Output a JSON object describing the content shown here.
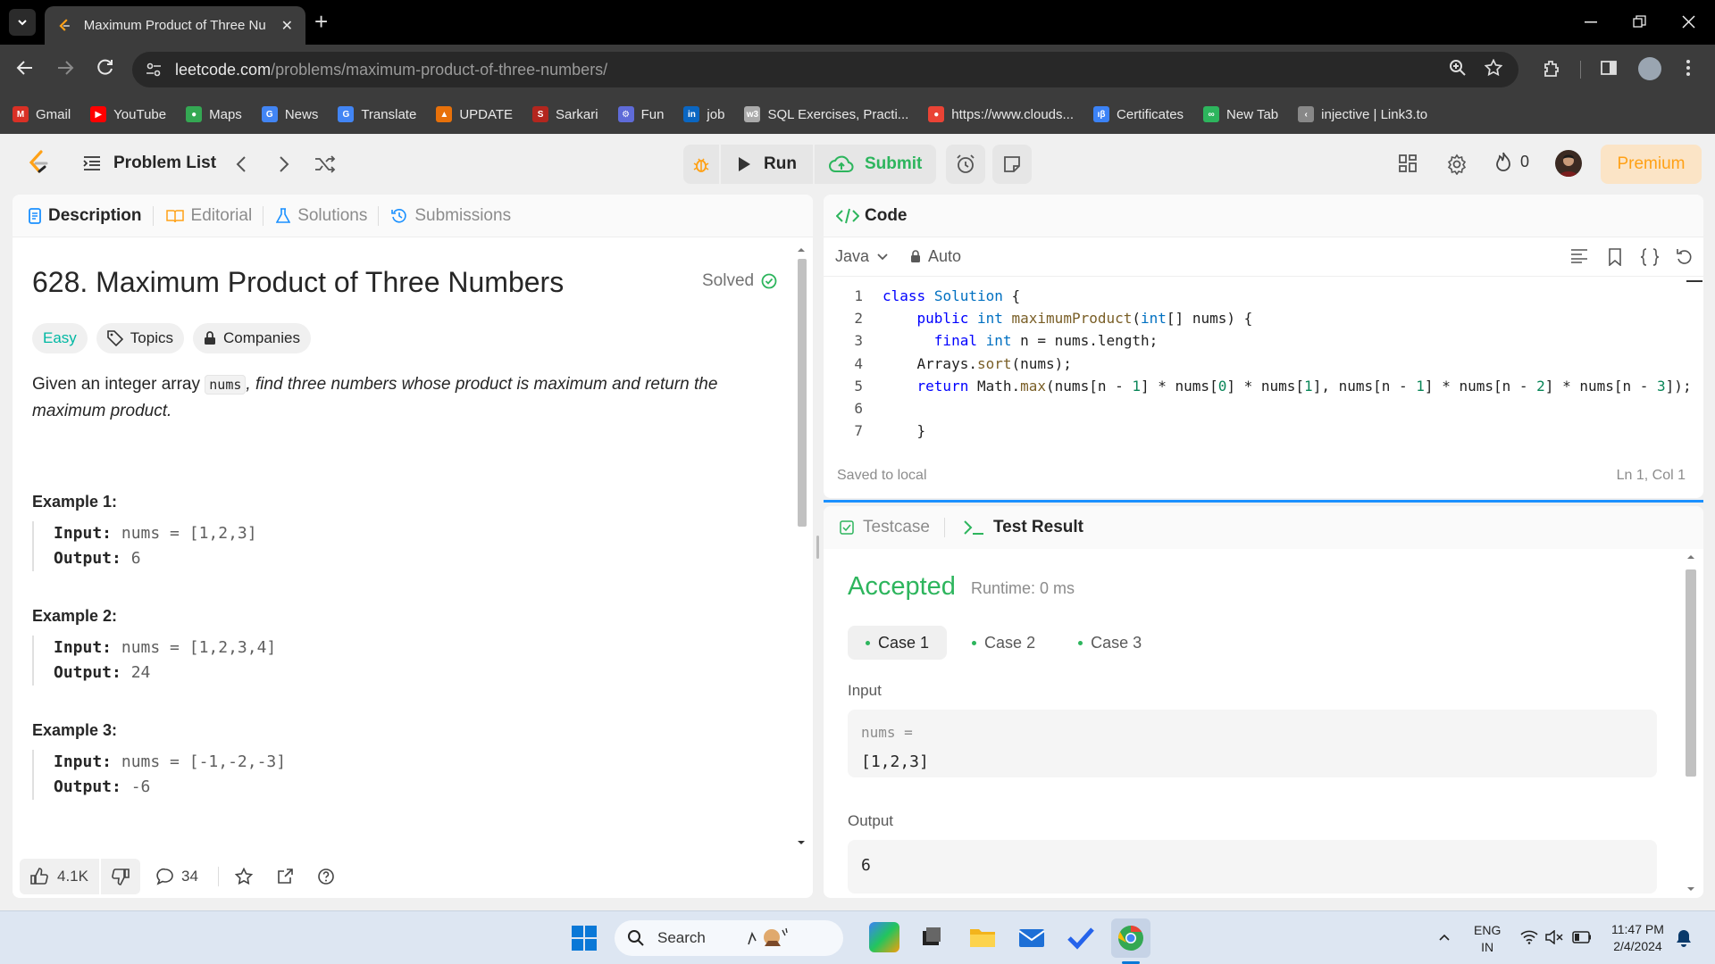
{
  "browser": {
    "tab_title": "Maximum Product of Three Nu",
    "close_glyph": "✕",
    "new_tab_glyph": "+",
    "url_host": "leetcode.com",
    "url_path": "/problems/maximum-product-of-three-numbers/",
    "bookmarks": [
      {
        "label": "Gmail",
        "icon": "gmail-icon",
        "color": "#d93025",
        "glyph": "M"
      },
      {
        "label": "YouTube",
        "icon": "youtube-icon",
        "color": "#ff0000",
        "glyph": "▶"
      },
      {
        "label": "Maps",
        "icon": "maps-icon",
        "color": "#34a853",
        "glyph": "●"
      },
      {
        "label": "News",
        "icon": "news-icon",
        "color": "#4285f4",
        "glyph": "G"
      },
      {
        "label": "Translate",
        "icon": "translate-icon",
        "color": "#4285f4",
        "glyph": "G"
      },
      {
        "label": "UPDATE",
        "icon": "update-icon",
        "color": "#e8710a",
        "glyph": "▲"
      },
      {
        "label": "Sarkari",
        "icon": "sarkari-icon",
        "color": "#b3261e",
        "glyph": "S"
      },
      {
        "label": "Fun",
        "icon": "fun-icon",
        "color": "#5f6bd8",
        "glyph": "⚙"
      },
      {
        "label": "job",
        "icon": "linkedin-icon",
        "color": "#0a66c2",
        "glyph": "in"
      },
      {
        "label": "SQL Exercises, Practi...",
        "icon": "w3-icon",
        "color": "#aaaaaa",
        "glyph": "w3"
      },
      {
        "label": "https://www.clouds...",
        "icon": "cloud-icon",
        "color": "#ea4335",
        "glyph": "●"
      },
      {
        "label": "Certificates",
        "icon": "certificates-icon",
        "color": "#3b82f6",
        "glyph": "ıβ"
      },
      {
        "label": "New Tab",
        "icon": "newtab-icon",
        "color": "#2db55d",
        "glyph": "∞"
      },
      {
        "label": "injective | Link3.to",
        "icon": "link3-icon",
        "color": "#888888",
        "glyph": "‹"
      }
    ]
  },
  "header": {
    "problem_list": "Problem List",
    "run": "Run",
    "submit": "Submit",
    "streak_count": "0",
    "premium": "Premium"
  },
  "description": {
    "tabs": [
      "Description",
      "Editorial",
      "Solutions",
      "Submissions"
    ],
    "title": "628. Maximum Product of Three Numbers",
    "solved": "Solved",
    "difficulty": "Easy",
    "topics": "Topics",
    "companies": "Companies",
    "statement_pre": "Given an integer array ",
    "statement_code": "nums",
    "statement_post": ", find three numbers whose product is maximum and return the maximum product.",
    "examples": [
      {
        "heading": "Example 1:",
        "input_label": "Input:",
        "input": "nums = [1,2,3]",
        "output_label": "Output:",
        "output": "6"
      },
      {
        "heading": "Example 2:",
        "input_label": "Input:",
        "input": "nums = [1,2,3,4]",
        "output_label": "Output:",
        "output": "24"
      },
      {
        "heading": "Example 3:",
        "input_label": "Input:",
        "input": "nums = [-1,-2,-3]",
        "output_label": "Output:",
        "output": "-6"
      }
    ],
    "likes": "4.1K",
    "comments": "34"
  },
  "code": {
    "title": "Code",
    "language": "Java",
    "mode": "Auto",
    "lines": [
      {
        "n": "1",
        "text": "class Solution {"
      },
      {
        "n": "2",
        "text": "    public int maximumProduct(int[] nums) {"
      },
      {
        "n": "3",
        "text": "      final int n = nums.length;"
      },
      {
        "n": "4",
        "text": "    Arrays.sort(nums);"
      },
      {
        "n": "5",
        "text": "    return Math.max(nums[n - 1] * nums[0] * nums[1], nums[n - 1] * nums[n - 2] * nums[n - 3]);"
      },
      {
        "n": "6",
        "text": ""
      },
      {
        "n": "7",
        "text": "    }"
      }
    ],
    "saved": "Saved to local",
    "cursor": "Ln 1, Col 1"
  },
  "result": {
    "tabs": [
      "Testcase",
      "Test Result"
    ],
    "verdict": "Accepted",
    "runtime": "Runtime: 0 ms",
    "cases": [
      "Case 1",
      "Case 2",
      "Case 3"
    ],
    "input_label": "Input",
    "input_name": "nums =",
    "input_value": "[1,2,3]",
    "output_label": "Output",
    "output_value": "6"
  },
  "taskbar": {
    "search": "Search",
    "lang_line1": "ENG",
    "lang_line2": "IN",
    "time": "11:47 PM",
    "date": "2/4/2024"
  },
  "colors": {
    "accepted": "#2db55d",
    "easy": "#00b8a3",
    "premium": "#ffa116",
    "link_blue": "#1a90ff"
  }
}
